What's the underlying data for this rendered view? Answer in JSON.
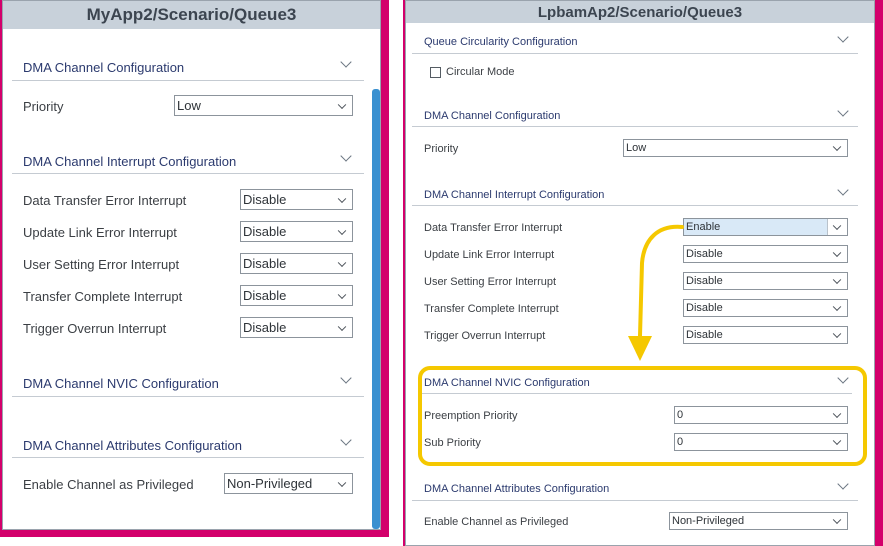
{
  "left": {
    "title": "MyApp2/Scenario/Queue3",
    "sections": {
      "dma_channel": "DMA Channel Configuration",
      "interrupt": "DMA Channel Interrupt Configuration",
      "nvic": "DMA Channel NVIC Configuration",
      "attributes": "DMA Channel Attributes Configuration"
    },
    "fields": {
      "priority": {
        "label": "Priority",
        "value": "Low"
      },
      "data_transfer_error": {
        "label": "Data Transfer Error Interrupt",
        "value": "Disable"
      },
      "update_link_error": {
        "label": "Update Link Error Interrupt",
        "value": "Disable"
      },
      "user_setting_error": {
        "label": "User Setting Error Interrupt",
        "value": "Disable"
      },
      "transfer_complete": {
        "label": "Transfer Complete Interrupt",
        "value": "Disable"
      },
      "trigger_overrun": {
        "label": "Trigger Overrun Interrupt",
        "value": "Disable"
      },
      "privileged": {
        "label": "Enable Channel as Privileged",
        "value": "Non-Privileged"
      }
    }
  },
  "right": {
    "title": "LpbamAp2/Scenario/Queue3",
    "sections": {
      "circularity": "Queue Circularity Configuration",
      "dma_channel": "DMA Channel Configuration",
      "interrupt": "DMA Channel Interrupt Configuration",
      "nvic": "DMA Channel NVIC Configuration",
      "attributes": "DMA Channel Attributes Configuration"
    },
    "circular_mode": {
      "label": "Circular Mode",
      "checked": false
    },
    "fields": {
      "priority": {
        "label": "Priority",
        "value": "Low"
      },
      "data_transfer_error": {
        "label": "Data Transfer Error Interrupt",
        "value": "Enable"
      },
      "update_link_error": {
        "label": "Update Link Error Interrupt",
        "value": "Disable"
      },
      "user_setting_error": {
        "label": "User Setting Error Interrupt",
        "value": "Disable"
      },
      "transfer_complete": {
        "label": "Transfer Complete Interrupt",
        "value": "Disable"
      },
      "trigger_overrun": {
        "label": "Trigger Overrun Interrupt",
        "value": "Disable"
      },
      "preemption_priority": {
        "label": "Preemption Priority",
        "value": "0"
      },
      "sub_priority": {
        "label": "Sub Priority",
        "value": "0"
      },
      "privileged": {
        "label": "Enable Channel as Privileged",
        "value": "Non-Privileged"
      }
    }
  },
  "colors": {
    "frame": "#d3006b",
    "highlight": "#f5c800",
    "scrollbar": "#3a90d0",
    "section_text": "#2b3a6e",
    "title_bar": "#c8d1da"
  }
}
